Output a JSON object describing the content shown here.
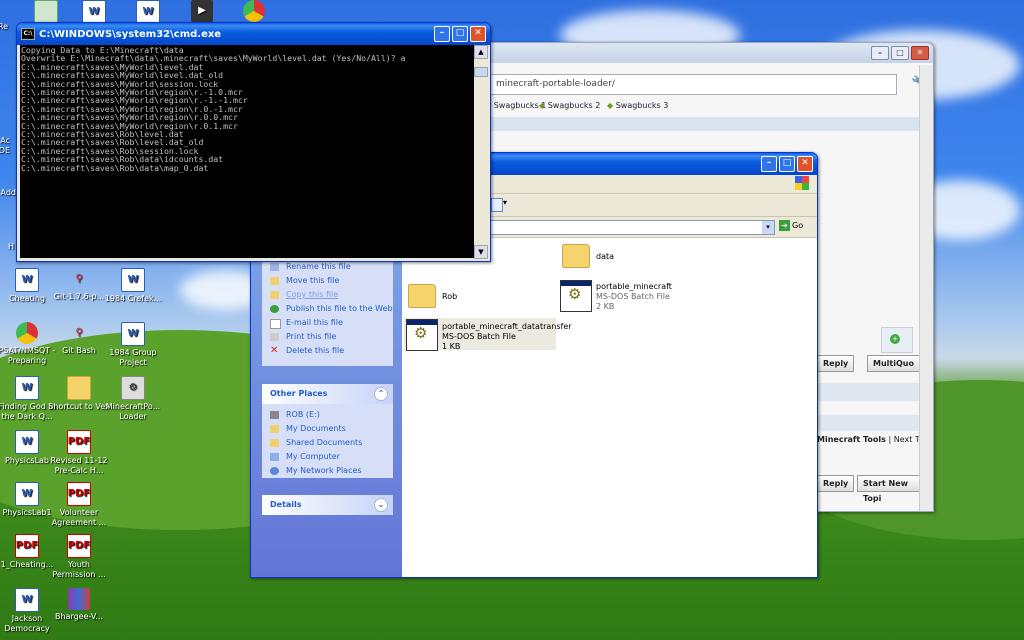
{
  "desktop": {
    "icons": [
      {
        "label": "Cheating",
        "icon": "word-doc-icon"
      },
      {
        "label": "Git-1.7.6-p...",
        "icon": "git-icon"
      },
      {
        "label": "1984 Crefek...",
        "icon": "word-doc-icon"
      },
      {
        "label": "PSAT/NMSQT - Preparing",
        "icon": "chrome-icon"
      },
      {
        "label": "Git Bash",
        "icon": "git-icon"
      },
      {
        "label": "1984 Group Project",
        "icon": "word-doc-icon"
      },
      {
        "label": "Finding God in the Dark Q...",
        "icon": "word-doc-icon"
      },
      {
        "label": "Shortcut to Vex",
        "icon": "folder-icon"
      },
      {
        "label": "MinecraftPo... Loader",
        "icon": "program-icon"
      },
      {
        "label": "PhysicsLab",
        "icon": "word-doc-icon"
      },
      {
        "label": "Revised 11-12 Pre-Calc H...",
        "icon": "pdf-icon"
      },
      {
        "label": "PhysicsLab1",
        "icon": "word-doc-icon"
      },
      {
        "label": "Volunteer Agreement ...",
        "icon": "pdf-icon"
      },
      {
        "label": "1_Cheating...",
        "icon": "pdf-icon"
      },
      {
        "label": "Youth Permission ...",
        "icon": "pdf-icon"
      },
      {
        "label": "Jackson Democracy",
        "icon": "word-doc-icon"
      },
      {
        "label": "Bhargee-V...",
        "icon": "winrar-icon"
      }
    ],
    "edge_labels": [
      "Re",
      "Ac",
      "DE",
      "Add",
      "H"
    ]
  },
  "cmd": {
    "title": "C:\\WINDOWS\\system32\\cmd.exe",
    "lines": [
      "Copying Data to E:\\Minecraft\\data",
      "Overwrite E:\\Minecraft\\data\\.minecraft\\saves\\MyWorld\\level.dat (Yes/No/All)? a",
      "C:\\.minecraft\\saves\\MyWorld\\level.dat",
      "C:\\.minecraft\\saves\\MyWorld\\level.dat_old",
      "C:\\.minecraft\\saves\\MyWorld\\session.lock",
      "C:\\.minecraft\\saves\\MyWorld\\region\\r.-1.0.mcr",
      "C:\\.minecraft\\saves\\MyWorld\\region\\r.-1.-1.mcr",
      "C:\\.minecraft\\saves\\MyWorld\\region\\r.0.-1.mcr",
      "C:\\.minecraft\\saves\\MyWorld\\region\\r.0.0.mcr",
      "C:\\.minecraft\\saves\\MyWorld\\region\\r.0.1.mcr",
      "C:\\.minecraft\\saves\\Rob\\level.dat",
      "C:\\.minecraft\\saves\\Rob\\level.dat_old",
      "C:\\.minecraft\\saves\\Rob\\session.lock",
      "C:\\.minecraft\\saves\\Rob\\data\\idcounts.dat",
      "C:\\.minecraft\\saves\\Rob\\data\\map_0.dat"
    ]
  },
  "browser": {
    "address": "minecraft-portable-loader/",
    "bookmarks": [
      "Swagbucks 1",
      "Swagbucks 2",
      "Swagbucks 3"
    ],
    "buttons": {
      "reply": "Reply",
      "multiquote": "MultiQuo",
      "quick_reply": "Reply",
      "new_topic": "Start New Topi"
    },
    "nav": {
      "tools": "Minecraft Tools",
      "next": "Next Topi"
    },
    "left_letters": {
      "s1": "S",
      "s2": "S"
    }
  },
  "explorer": {
    "go_label": "Go",
    "file_tasks": [
      {
        "label": "Rename this file",
        "icon": "rename-icon",
        "enabled": true
      },
      {
        "label": "Move this file",
        "icon": "move-icon",
        "enabled": true
      },
      {
        "label": "Copy this file",
        "icon": "copy-icon",
        "enabled": false
      },
      {
        "label": "Publish this file to the Web",
        "icon": "web-icon",
        "enabled": true
      },
      {
        "label": "E-mail this file",
        "icon": "email-icon",
        "enabled": true
      },
      {
        "label": "Print this file",
        "icon": "print-icon",
        "enabled": true
      },
      {
        "label": "Delete this file",
        "icon": "delete-icon",
        "enabled": true
      }
    ],
    "other_places": {
      "title": "Other Places",
      "items": [
        "ROB (E:)",
        "My Documents",
        "Shared Documents",
        "My Computer",
        "My Network Places"
      ]
    },
    "details": {
      "title": "Details"
    },
    "files": [
      {
        "name": "data",
        "kind": "folder"
      },
      {
        "name": "Rob",
        "kind": "folder"
      },
      {
        "name": "portable_minecraft",
        "type": "MS-DOS Batch File",
        "size": "2 KB"
      },
      {
        "name": "portable_minecraft_datatransfer",
        "type": "MS-DOS Batch File",
        "size": "1 KB"
      }
    ]
  }
}
